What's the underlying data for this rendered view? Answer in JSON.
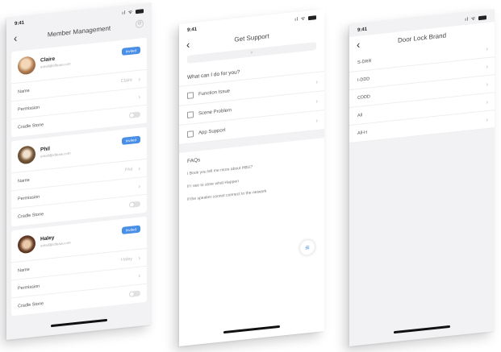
{
  "screens": {
    "member": {
      "time": "9:41",
      "title": "Member Management",
      "members": [
        {
          "name": "Claire",
          "email": "email@idleaw.com",
          "badge": "Invited",
          "rows": [
            {
              "label": "Name",
              "value": "Claire"
            },
            {
              "label": "Permission",
              "value": ""
            },
            {
              "label": "Cradle Stone",
              "value": ""
            }
          ]
        },
        {
          "name": "Phil",
          "email": "email@idleaw.com",
          "badge": "Invited",
          "rows": [
            {
              "label": "Name",
              "value": "Phil"
            },
            {
              "label": "Permission",
              "value": ""
            },
            {
              "label": "Cradle Stone",
              "value": ""
            }
          ]
        },
        {
          "name": "Haley",
          "email": "email@idleaw.com",
          "badge": "Invited",
          "rows": [
            {
              "label": "Name",
              "value": "Haley"
            },
            {
              "label": "Permission",
              "value": ""
            },
            {
              "label": "Cradle Stone",
              "value": ""
            }
          ]
        }
      ]
    },
    "support": {
      "time": "9:41",
      "title": "Get Support",
      "search_icon": "⌕",
      "question": "What can I do for you?",
      "items": [
        {
          "label": "Function Issue"
        },
        {
          "label": "Scene Problem"
        },
        {
          "label": "App Support"
        }
      ],
      "faq_title": "FAQs",
      "faqs": [
        "I Book you tell me more about HBU?",
        "If I see to store what Happen",
        "If the speaker cannot connect to the network"
      ],
      "fab_icon": "≡"
    },
    "doorlock": {
      "time": "9:41",
      "title": "Door Lock Brand",
      "brands": [
        "S-DRR",
        "I-DDD",
        "CDDD",
        "All",
        "All-H"
      ]
    }
  },
  "colors": {
    "accent": "#4a8fe7",
    "background": "#f2f2f4"
  }
}
